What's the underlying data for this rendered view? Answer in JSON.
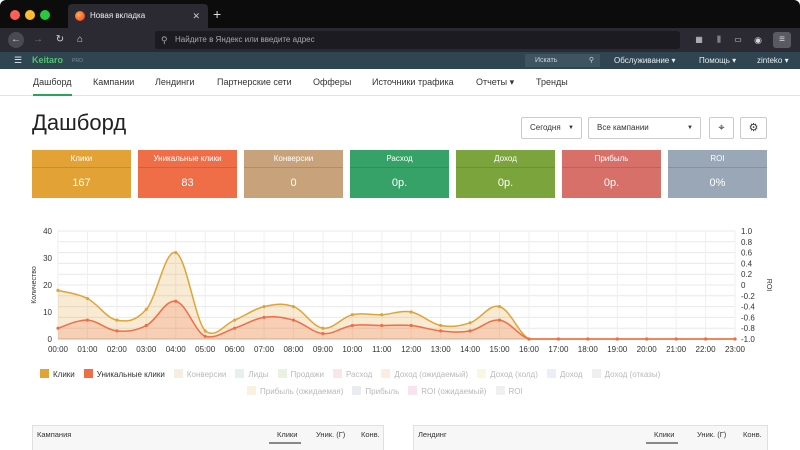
{
  "browser": {
    "tab_title": "Новая вкладка",
    "new_tab_glyph": "+",
    "close_glyph": "✕",
    "url_placeholder": "Найдите в Яндекс или введите адрес"
  },
  "app": {
    "brand": "Keitaro",
    "edition": "PRO",
    "search_label": "Искать",
    "menu": [
      "Обслуживание ▾",
      "Помощь ▾",
      "zinteko ▾"
    ]
  },
  "nav": {
    "items": [
      "Дашборд",
      "Кампании",
      "Лендинги",
      "Партнерские сети",
      "Офферы",
      "Источники трафика",
      "Отчеты ▾",
      "Тренды"
    ],
    "active_index": 0
  },
  "page": {
    "title": "Дашборд",
    "period": "Сегодня",
    "campaigns": "Все кампании"
  },
  "stats": [
    {
      "label": "Клики",
      "value": "167",
      "color": "#e3a235"
    },
    {
      "label": "Уникальные клики",
      "value": "83",
      "color": "#ef6e47"
    },
    {
      "label": "Конверсии",
      "value": "0",
      "color": "#c7a27a"
    },
    {
      "label": "Расход",
      "value": "0р.",
      "color": "#36a267"
    },
    {
      "label": "Доход",
      "value": "0р.",
      "color": "#7ca43c"
    },
    {
      "label": "Прибыль",
      "value": "0р.",
      "color": "#d8706a"
    },
    {
      "label": "ROI",
      "value": "0%",
      "color": "#9aa7b7"
    }
  ],
  "chart_data": {
    "type": "area",
    "title": "",
    "xlabel": "",
    "ylabel": "Количество",
    "y2label": "ROI",
    "categories": [
      "00:00",
      "01:00",
      "02:00",
      "03:00",
      "04:00",
      "05:00",
      "06:00",
      "07:00",
      "08:00",
      "09:00",
      "10:00",
      "11:00",
      "12:00",
      "13:00",
      "14:00",
      "15:00",
      "16:00",
      "17:00",
      "18:00",
      "19:00",
      "20:00",
      "21:00",
      "22:00",
      "23:00"
    ],
    "ylim": [
      0,
      40
    ],
    "yticks": [
      0,
      10,
      20,
      30,
      40
    ],
    "y2lim": [
      -1.0,
      1.0
    ],
    "y2ticks": [
      "1.0",
      "0.8",
      "0.6",
      "0.4",
      "0.2",
      "0",
      "-0.2",
      "-0.4",
      "-0.6",
      "-0.8",
      "-1.0"
    ],
    "grid": true,
    "legend_position": "bottom",
    "series": [
      {
        "name": "Клики",
        "color": "#e3a235",
        "values": [
          18,
          15,
          7,
          11,
          32,
          3,
          7,
          12,
          12,
          4,
          9,
          9,
          10,
          5,
          6,
          12,
          0,
          0,
          0,
          0,
          0,
          0,
          0,
          0
        ]
      },
      {
        "name": "Уникальные клики",
        "color": "#ef6e47",
        "values": [
          4,
          7,
          3,
          5,
          14,
          1,
          4,
          8,
          7,
          2,
          5,
          5,
          5,
          3,
          3,
          7,
          0,
          0,
          0,
          0,
          0,
          0,
          0,
          0
        ]
      }
    ],
    "legend": [
      {
        "name": "Клики",
        "color": "#e3a235",
        "active": true
      },
      {
        "name": "Уникальные клики",
        "color": "#ef6e47",
        "active": true
      },
      {
        "name": "Конверсии",
        "color": "#e8cfa9",
        "active": false
      },
      {
        "name": "Лиды",
        "color": "#b7d9c4",
        "active": false
      },
      {
        "name": "Продажи",
        "color": "#c3dba9",
        "active": false
      },
      {
        "name": "Расход",
        "color": "#f2b9b4",
        "active": false
      },
      {
        "name": "Доход (ожидаемый)",
        "color": "#f1cfae",
        "active": false
      },
      {
        "name": "Доход (холд)",
        "color": "#f3e7ae",
        "active": false
      },
      {
        "name": "Доход",
        "color": "#c6d2ea",
        "active": false
      },
      {
        "name": "Доход (отказы)",
        "color": "#d2d2d2",
        "active": false
      },
      {
        "name": "Прибыль (ожидаемая)",
        "color": "#f1d9a9",
        "active": false
      },
      {
        "name": "Прибыль",
        "color": "#c3ced8",
        "active": false
      },
      {
        "name": "ROI (ожидаемый)",
        "color": "#eab4d0",
        "active": false
      },
      {
        "name": "ROI",
        "color": "#d6d6d6",
        "active": false
      }
    ]
  },
  "tables": {
    "campaigns": {
      "headers": [
        "Кампания",
        "Клики",
        "Уник. (Г)",
        "Конв."
      ]
    },
    "landings": {
      "headers": [
        "Лендинг",
        "Клики",
        "Уник. (Г)",
        "Конв."
      ]
    }
  }
}
